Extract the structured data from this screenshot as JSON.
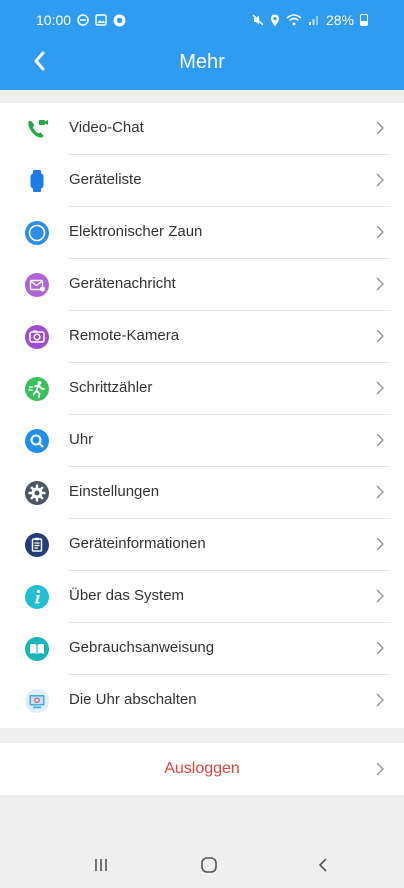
{
  "statusbar": {
    "time": "10:00",
    "battery": "28%"
  },
  "header": {
    "title": "Mehr",
    "background": "#2f9bf1"
  },
  "menu": {
    "items": [
      {
        "label": "Video-Chat",
        "icon": "video-call-icon",
        "color": "#22a849"
      },
      {
        "label": "Geräteliste",
        "icon": "watch-icon",
        "color": "#1e7be6"
      },
      {
        "label": "Elektronischer Zaun",
        "icon": "fence-circle-icon",
        "color": "#2d8ee8"
      },
      {
        "label": "Gerätenachricht",
        "icon": "message-icon",
        "color": "#b063d6"
      },
      {
        "label": "Remote-Kamera",
        "icon": "camera-icon",
        "color": "#a04dd0"
      },
      {
        "label": "Schrittzähler",
        "icon": "pedometer-icon",
        "color": "#39c05c"
      },
      {
        "label": "Uhr",
        "icon": "search-icon",
        "color": "#1f8ee6"
      },
      {
        "label": "Einstellungen",
        "icon": "gear-icon",
        "color": "#4b5563"
      },
      {
        "label": "Geräteinformationen",
        "icon": "device-info-icon",
        "color": "#233c7a"
      },
      {
        "label": "Über das System",
        "icon": "info-icon",
        "color": "#20bfd2"
      },
      {
        "label": "Gebrauchsanweisung",
        "icon": "manual-book-icon",
        "color": "#19b5b7"
      },
      {
        "label": "Die Uhr abschalten",
        "icon": "power-off-monitor-icon",
        "color": "#4aa8e0"
      }
    ]
  },
  "logout": {
    "label": "Ausloggen",
    "color": "#e0463f"
  }
}
